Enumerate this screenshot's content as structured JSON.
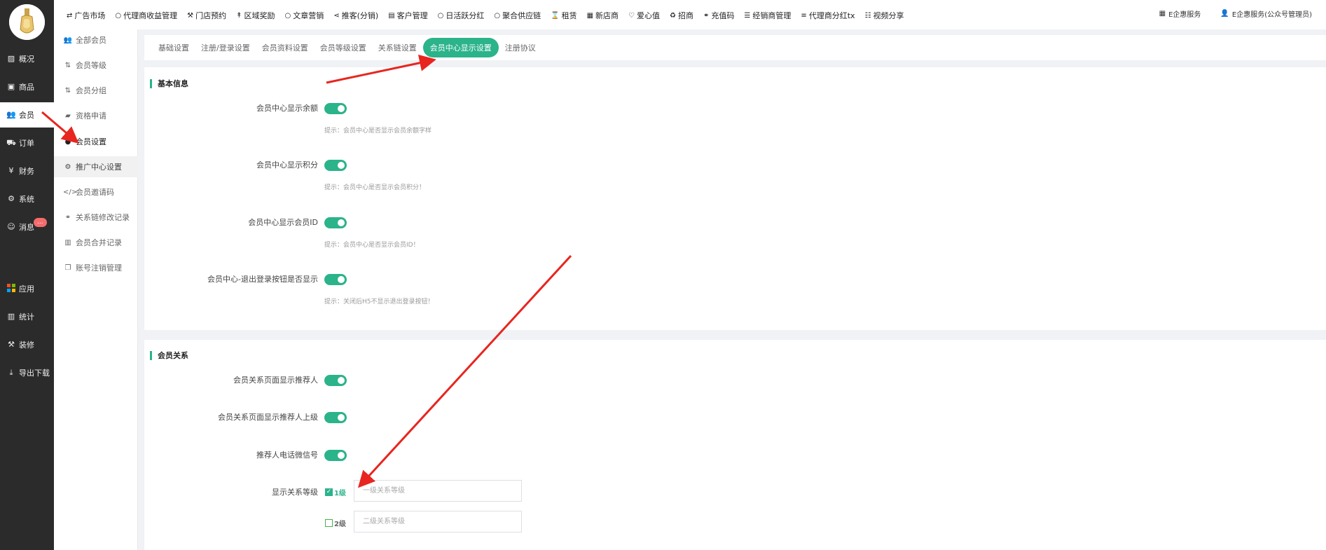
{
  "sidebar": {
    "items": [
      {
        "label": "概况",
        "icon": "dashboard-icon"
      },
      {
        "label": "商品",
        "icon": "goods-icon"
      },
      {
        "label": "会员",
        "icon": "member-icon"
      },
      {
        "label": "订单",
        "icon": "cart-icon"
      },
      {
        "label": "财务",
        "icon": "finance-icon"
      },
      {
        "label": "系统",
        "icon": "gear-icon"
      },
      {
        "label": "消息",
        "icon": "message-icon"
      },
      {
        "label": "应用",
        "icon": "apps-icon"
      },
      {
        "label": "统计",
        "icon": "chart-icon"
      },
      {
        "label": "装修",
        "icon": "brush-icon"
      },
      {
        "label": "导出下载",
        "icon": "download-icon"
      }
    ],
    "message_badge": "..."
  },
  "topbar": {
    "menu": [
      "广告市场",
      "代理商收益管理",
      "门店预约",
      "区域奖励",
      "文章营销",
      "推客(分销)",
      "客户管理",
      "日活跃分红",
      "聚合供应链",
      "租赁",
      "新店商",
      "爱心值",
      "招商",
      "充值码",
      "经销商管理",
      "代理商分红tx",
      "视频分享"
    ],
    "right": [
      "E企惠服务",
      "E企惠服务(公众号管理员)"
    ]
  },
  "submenu": {
    "items": [
      "全部会员",
      "会员等级",
      "会员分组",
      "资格申请",
      "会员设置",
      "推广中心设置",
      "会员邀请码",
      "关系链修改记录",
      "会员合并记录",
      "账号注销管理"
    ]
  },
  "tabs": [
    "基础设置",
    "注册/登录设置",
    "会员资料设置",
    "会员等级设置",
    "关系链设置",
    "会员中心显示设置",
    "注册协议"
  ],
  "section1": {
    "title": "基本信息",
    "rows": [
      {
        "label": "会员中心显示余额",
        "hint": "提示：会员中心是否显示会员余额字样"
      },
      {
        "label": "会员中心显示积分",
        "hint": "提示：会员中心是否显示会员积分！"
      },
      {
        "label": "会员中心显示会员ID",
        "hint": "提示：会员中心是否显示会员ID！"
      },
      {
        "label": "会员中心-退出登录按钮是否显示",
        "hint": "提示：关闭后H5不显示退出登录按钮！"
      }
    ]
  },
  "section2": {
    "title": "会员关系",
    "rows": [
      {
        "label": "会员关系页面显示推荐人"
      },
      {
        "label": "会员关系页面显示推荐人上级"
      },
      {
        "label": "推荐人电话微信号"
      }
    ],
    "level_label": "显示关系等级",
    "levels": [
      {
        "label": "1级",
        "checked": true,
        "placeholder": "一级关系等级"
      },
      {
        "label": "2级",
        "checked": false,
        "placeholder": "二级关系等级"
      }
    ]
  },
  "colors": {
    "accent": "#2bb38a",
    "sidebar_bg": "#2b2b2b",
    "arrow": "#e8251f"
  }
}
